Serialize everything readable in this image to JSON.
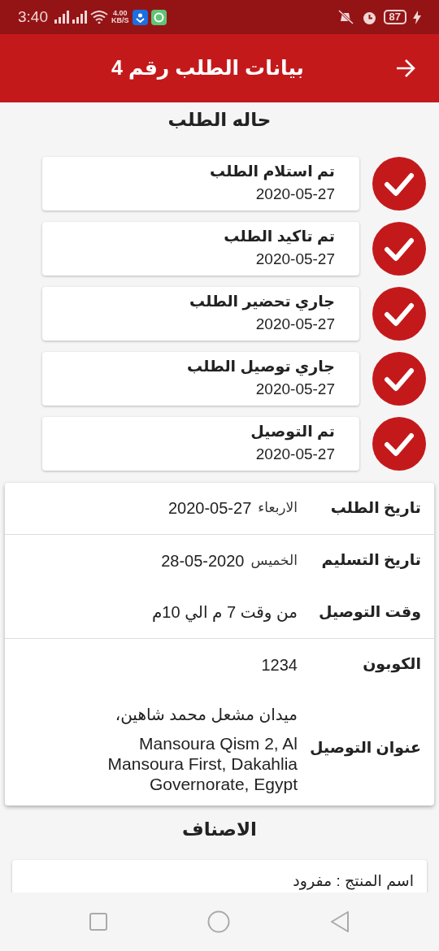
{
  "status_bar": {
    "time": "3:40",
    "speed_value": "4.00",
    "speed_unit": "KB/S",
    "battery": "87"
  },
  "app_bar": {
    "title": "بيانات الطلب رقم 4"
  },
  "status_section": {
    "title": "حاله الطلب",
    "steps": [
      {
        "title": "تم استلام الطلب",
        "date": "2020-05-27",
        "done": true
      },
      {
        "title": "تم تاكيد الطلب",
        "date": "2020-05-27",
        "done": true
      },
      {
        "title": "جاري تحضير الطلب",
        "date": "2020-05-27",
        "done": true
      },
      {
        "title": "جاري توصيل الطلب",
        "date": "2020-05-27",
        "done": true
      },
      {
        "title": "تم التوصيل",
        "date": "2020-05-27",
        "done": true
      }
    ]
  },
  "details": [
    {
      "label": "تاريخ الطلب",
      "kind": "dated",
      "day": "الاربعاء",
      "value": "2020-05-27",
      "divider_after": true
    },
    {
      "label": "تاريخ التسليم",
      "kind": "dated",
      "day": "الخميس",
      "value": "28-05-2020",
      "divider_after": false
    },
    {
      "label": "وقت التوصيل",
      "kind": "plain",
      "value": "من وقت 7 م الي 10م",
      "divider_after": true
    },
    {
      "label": "الكوبون",
      "kind": "plain",
      "value": "1234",
      "divider_after": false
    },
    {
      "label": "عنوان التوصيل",
      "kind": "address",
      "lines": [
        "ميدان مشعل محمد شاهين،",
        "Mansoura Qism 2, Al Mansoura First, Dakahlia Governorate, Egypt"
      ],
      "divider_after": false
    }
  ],
  "items_section": {
    "title": "الاصناف",
    "items": [
      {
        "text": "اسم المنتج : مفرود"
      }
    ]
  }
}
